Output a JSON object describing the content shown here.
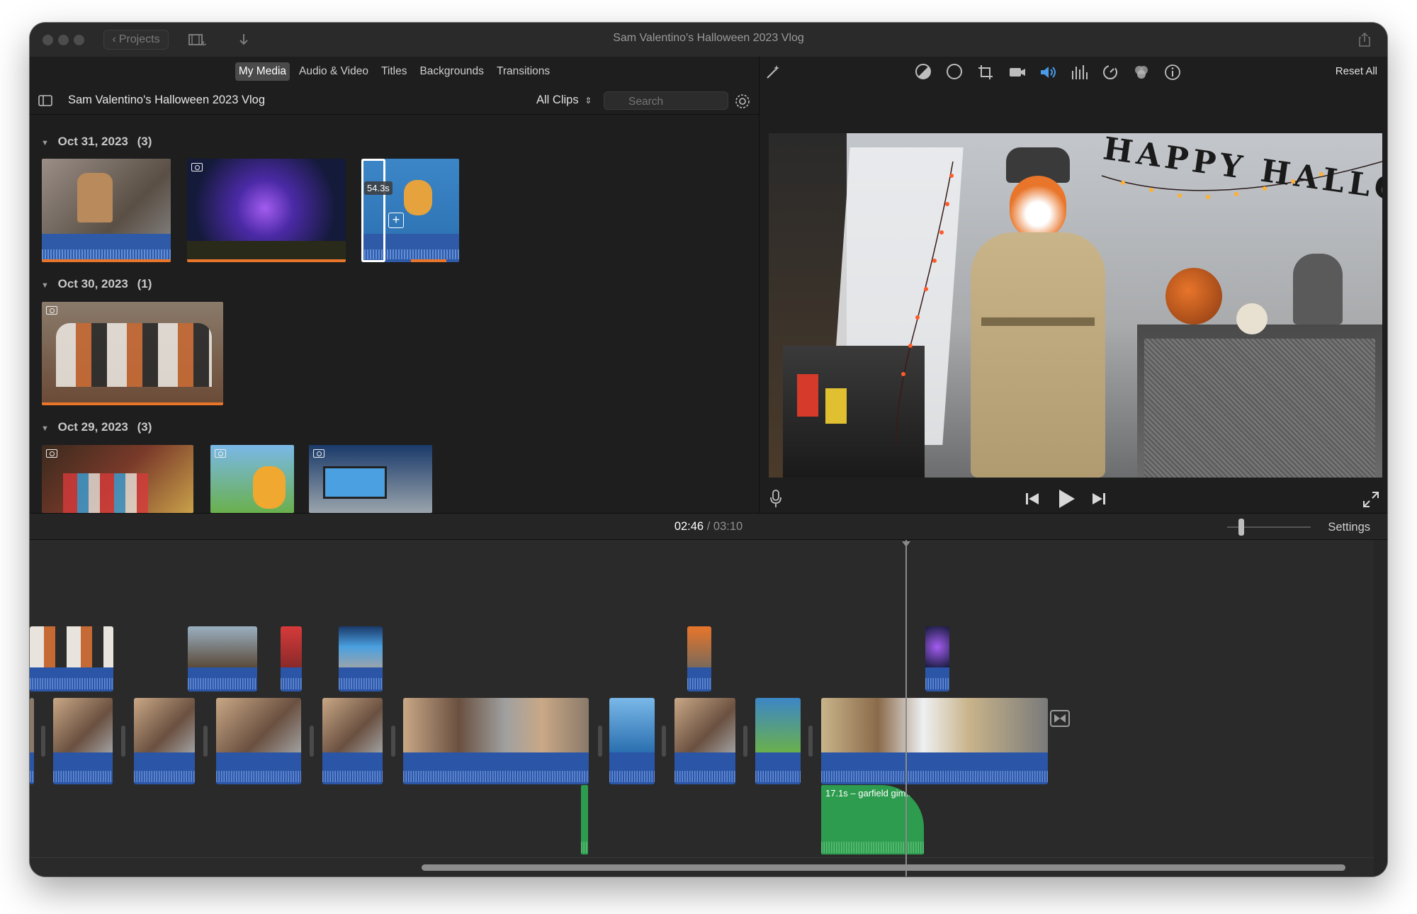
{
  "window": {
    "title": "Sam Valentino's Halloween 2023 Vlog",
    "projects_label": "Projects"
  },
  "browser": {
    "tabs": [
      {
        "label": "My Media",
        "active": true
      },
      {
        "label": "Audio & Video",
        "active": false
      },
      {
        "label": "Titles",
        "active": false
      },
      {
        "label": "Backgrounds",
        "active": false
      },
      {
        "label": "Transitions",
        "active": false
      }
    ],
    "library_title": "Sam Valentino's Halloween 2023 Vlog",
    "filter_label": "All Clips",
    "search_placeholder": "Search",
    "groups": [
      {
        "date": "Oct 31, 2023",
        "count": "(3)"
      },
      {
        "date": "Oct 30, 2023",
        "count": "(1)"
      },
      {
        "date": "Oct 29, 2023",
        "count": "(3)"
      }
    ],
    "skim_duration": "54.3s"
  },
  "viewer": {
    "reset_all_label": "Reset All",
    "banner_text": "HAPPY HALLOW"
  },
  "timeline": {
    "current_time": "02:46",
    "separator": "/",
    "total_time": "03:10",
    "settings_label": "Settings",
    "audio_clip_label": "17.1s – garfield gim..."
  },
  "colors": {
    "accent_blue": "#2b55a6",
    "audio_green": "#2e9c4e",
    "selection_orange": "#e8752a"
  }
}
